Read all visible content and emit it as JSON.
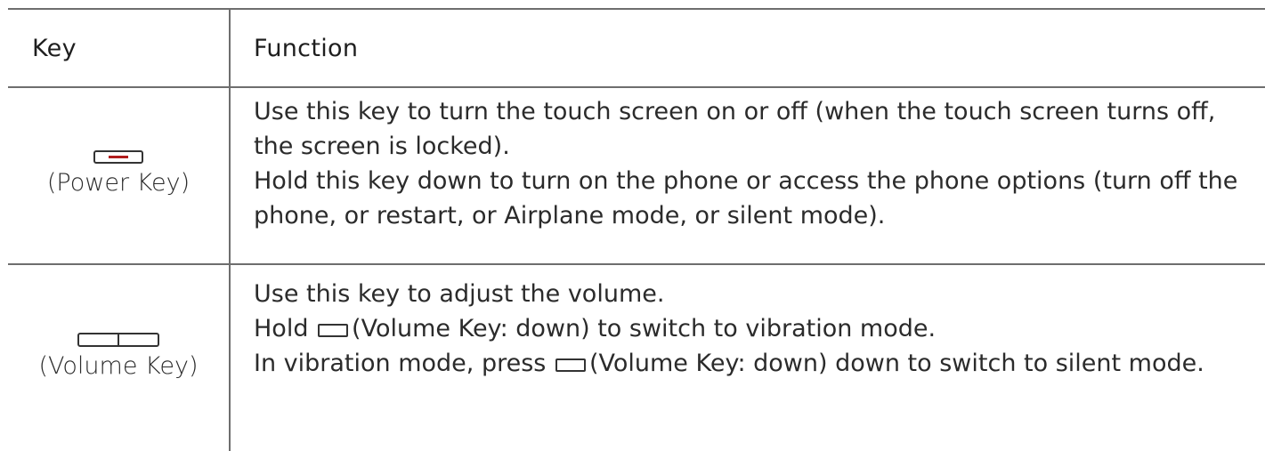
{
  "header": {
    "key_label": "Key",
    "function_label": "Function"
  },
  "rows": [
    {
      "key_icon": "power-key-icon",
      "key_name": "(Power Key)",
      "lines": [
        "Use this key to turn the touch screen on or off (when the touch screen turns off, the screen is locked).",
        "Hold this key down to turn on the phone or access the phone options (turn off the phone, or restart, or Airplane mode, or silent mode)."
      ]
    },
    {
      "key_icon": "volume-key-icon",
      "key_name": "(Volume Key)",
      "line1": "Use this key to adjust the volume.",
      "line2_pre": "Hold",
      "line2_post": "(Volume Key: down) to switch to vibration mode.",
      "line3_pre": "In vibration mode, press",
      "line3_post": "(Volume Key: down) down to switch to silent mode."
    }
  ],
  "colors": {
    "power_accent": "#b01c1c",
    "rule": "#6e6e6e",
    "text": "#2b2b2b"
  }
}
